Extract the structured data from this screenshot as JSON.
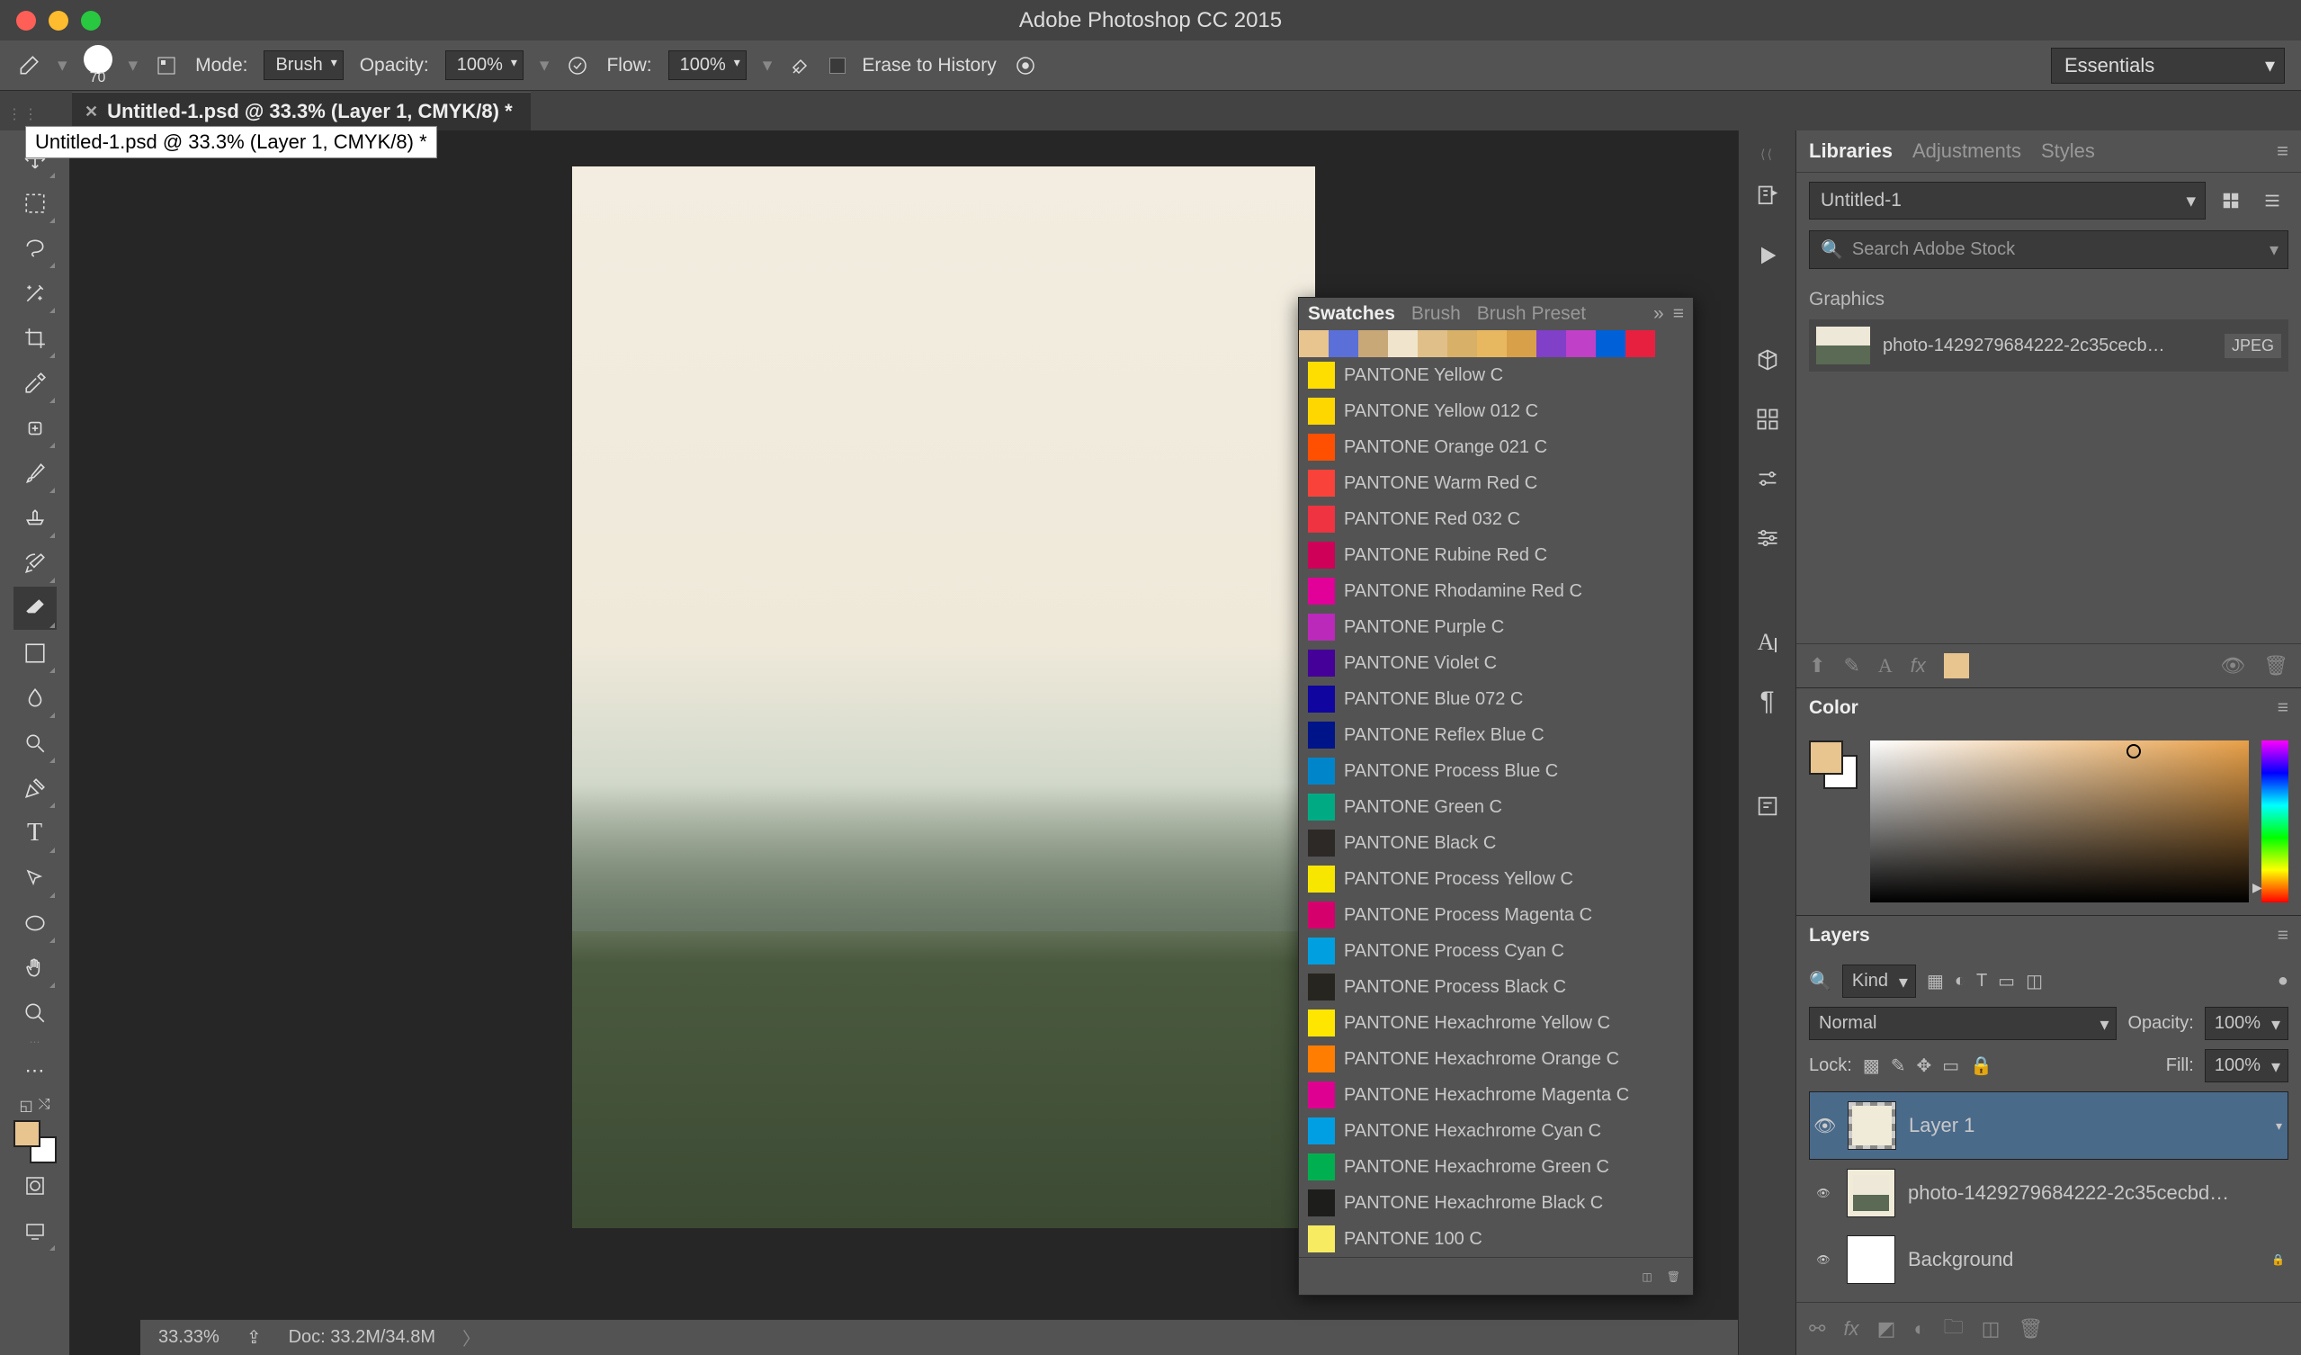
{
  "app_title": "Adobe Photoshop CC 2015",
  "options_bar": {
    "brush_size": "70",
    "mode_label": "Mode:",
    "mode_value": "Brush",
    "opacity_label": "Opacity:",
    "opacity_value": "100%",
    "flow_label": "Flow:",
    "flow_value": "100%",
    "erase_history_label": "Erase to History",
    "workspace": "Essentials"
  },
  "document_tab": "Untitled-1.psd @ 33.3% (Layer 1, CMYK/8) *",
  "tooltip": "Untitled-1.psd @ 33.3% (Layer 1, CMYK/8) *",
  "statusbar": {
    "zoom": "33.33%",
    "doc": "Doc: 33.2M/34.8M"
  },
  "swatches": {
    "tabs": [
      "Swatches",
      "Brush",
      "Brush Preset"
    ],
    "top_colors": [
      "#e8c48f",
      "#5a6fd8",
      "#c9a878",
      "#f0e4cc",
      "#e0c088",
      "#d8b068",
      "#e8b860",
      "#d8a048",
      "#8040c8",
      "#c040c8",
      "#0060d8",
      "#e82040"
    ],
    "list": [
      {
        "name": "PANTONE Yellow C",
        "color": "#fedd00"
      },
      {
        "name": "PANTONE Yellow 012 C",
        "color": "#ffd700"
      },
      {
        "name": "PANTONE Orange 021 C",
        "color": "#fe5000"
      },
      {
        "name": "PANTONE Warm Red C",
        "color": "#f9423a"
      },
      {
        "name": "PANTONE Red 032 C",
        "color": "#ef3340"
      },
      {
        "name": "PANTONE Rubine Red C",
        "color": "#ce0058"
      },
      {
        "name": "PANTONE Rhodamine Red C",
        "color": "#e10098"
      },
      {
        "name": "PANTONE Purple C",
        "color": "#bb29bb"
      },
      {
        "name": "PANTONE Violet C",
        "color": "#440099"
      },
      {
        "name": "PANTONE Blue 072 C",
        "color": "#10069f"
      },
      {
        "name": "PANTONE Reflex Blue C",
        "color": "#001489"
      },
      {
        "name": "PANTONE Process Blue C",
        "color": "#0085ca"
      },
      {
        "name": "PANTONE Green C",
        "color": "#00ab84"
      },
      {
        "name": "PANTONE Black C",
        "color": "#2d2926"
      },
      {
        "name": "PANTONE Process Yellow C",
        "color": "#f7e600"
      },
      {
        "name": "PANTONE Process Magenta C",
        "color": "#d6006d"
      },
      {
        "name": "PANTONE Process Cyan C",
        "color": "#009fdf"
      },
      {
        "name": "PANTONE Process Black C",
        "color": "#27251f"
      },
      {
        "name": "PANTONE Hexachrome Yellow C",
        "color": "#ffe600"
      },
      {
        "name": "PANTONE Hexachrome Orange C",
        "color": "#ff7d00"
      },
      {
        "name": "PANTONE Hexachrome Magenta C",
        "color": "#de0090"
      },
      {
        "name": "PANTONE Hexachrome Cyan C",
        "color": "#009fe3"
      },
      {
        "name": "PANTONE Hexachrome Green C",
        "color": "#00b050"
      },
      {
        "name": "PANTONE Hexachrome Black C",
        "color": "#1d1d1b"
      },
      {
        "name": "PANTONE 100 C",
        "color": "#f6eb61"
      }
    ]
  },
  "right": {
    "tabs": [
      "Libraries",
      "Adjustments",
      "Styles"
    ],
    "library_name": "Untitled-1",
    "search_placeholder": "Search Adobe Stock",
    "section": "Graphics",
    "asset_name": "photo-1429279684222-2c35cecb…",
    "asset_badge": "JPEG"
  },
  "color_panel": {
    "title": "Color"
  },
  "layers": {
    "title": "Layers",
    "filter": "Kind",
    "blend": "Normal",
    "opacity_label": "Opacity:",
    "opacity_value": "100%",
    "lock_label": "Lock:",
    "fill_label": "Fill:",
    "fill_value": "100%",
    "items": [
      {
        "name": "Layer 1"
      },
      {
        "name": "photo-1429279684222-2c35cecbd…"
      },
      {
        "name": "Background"
      }
    ]
  }
}
